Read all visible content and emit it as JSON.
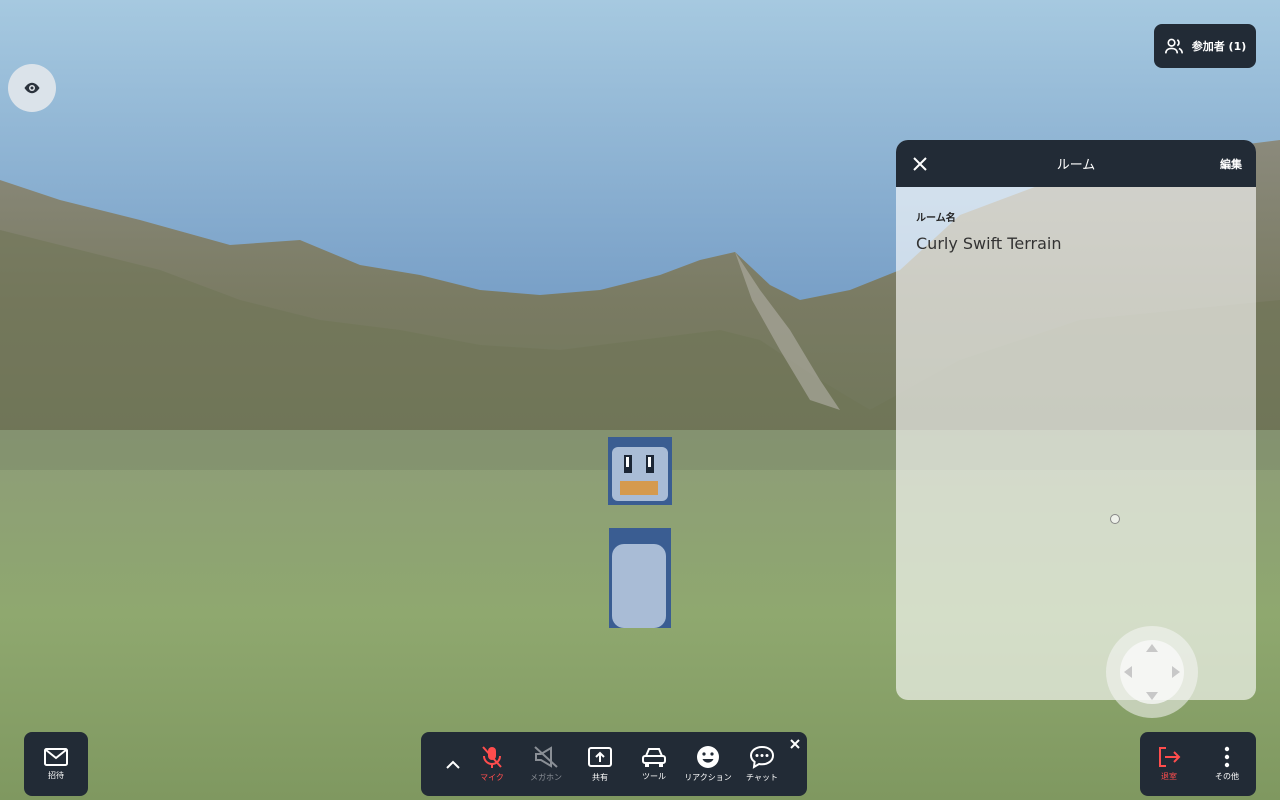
{
  "participants": {
    "label": "参加者 (1)"
  },
  "panel": {
    "title": "ルーム",
    "edit_label": "編集",
    "room_name_label": "ルーム名",
    "room_name_value": "Curly Swift Terrain"
  },
  "toolbar": {
    "invite_label": "招待",
    "mic_label": "マイク",
    "megaphone_label": "メガホン",
    "share_label": "共有",
    "tools_label": "ツール",
    "reaction_label": "リアクション",
    "chat_label": "チャット",
    "leave_label": "退室",
    "more_label": "その他"
  },
  "colors": {
    "toolbar_bg": "#222b36",
    "accent_red": "#ff4d4d",
    "sky": "#5b86b4",
    "grass": "#8fa775"
  }
}
